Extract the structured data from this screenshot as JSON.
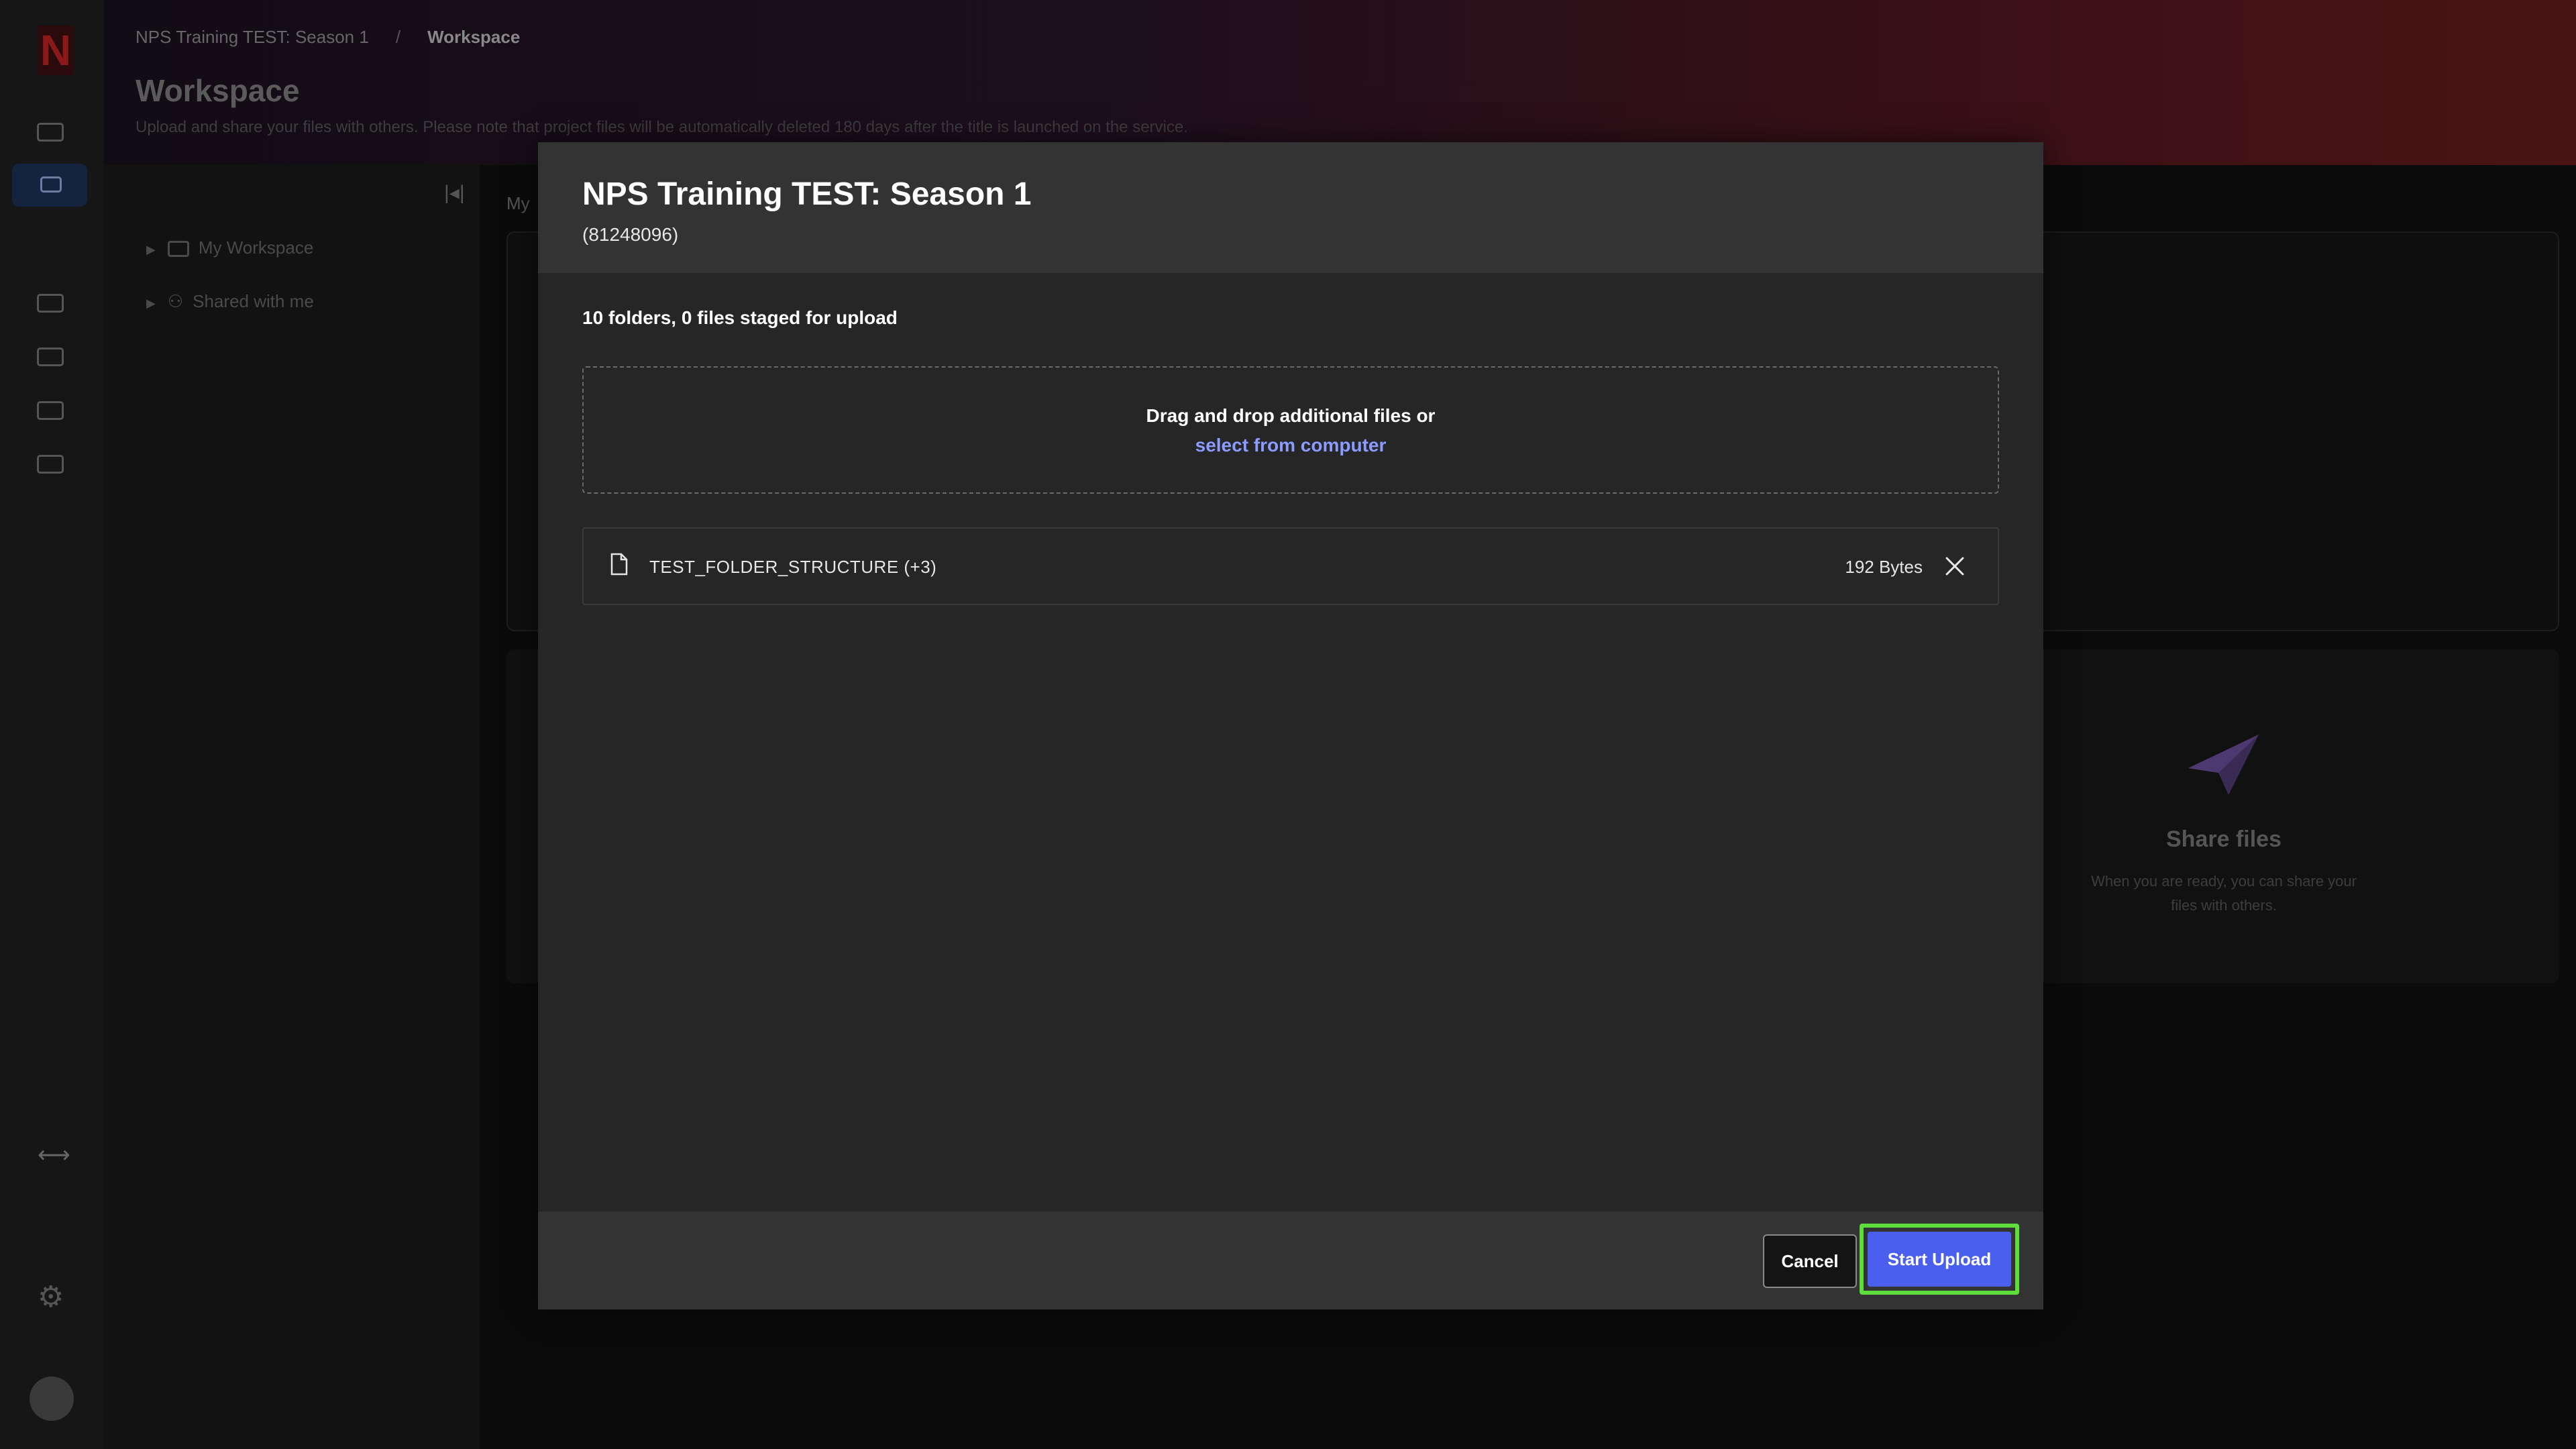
{
  "breadcrumb": {
    "project": "NPS Training TEST: Season 1",
    "separator": "/",
    "current": "Workspace"
  },
  "page": {
    "title": "Workspace",
    "subtitle": "Upload and share your files with others. Please note that project files will be automatically deleted 180 days after the title is launched on the service."
  },
  "tree": {
    "items": [
      {
        "label": "My Workspace"
      },
      {
        "label": "Shared with me"
      }
    ]
  },
  "main": {
    "my_label": "My",
    "share_title": "Share files",
    "share_desc": "When you are ready, you can share your files with others."
  },
  "modal": {
    "title": "NPS Training TEST: Season 1",
    "id": "(81248096)",
    "status": "10 folders, 0 files staged for upload",
    "dropzone_text": "Drag and drop additional files or",
    "dropzone_link": "select from computer",
    "files": [
      {
        "name": "TEST_FOLDER_STRUCTURE (+3)",
        "size": "192 Bytes"
      }
    ],
    "cancel_label": "Cancel",
    "start_label": "Start Upload"
  },
  "colors": {
    "primary": "#4b5fef",
    "highlight": "#5dde3c",
    "link": "#8b9bff"
  }
}
